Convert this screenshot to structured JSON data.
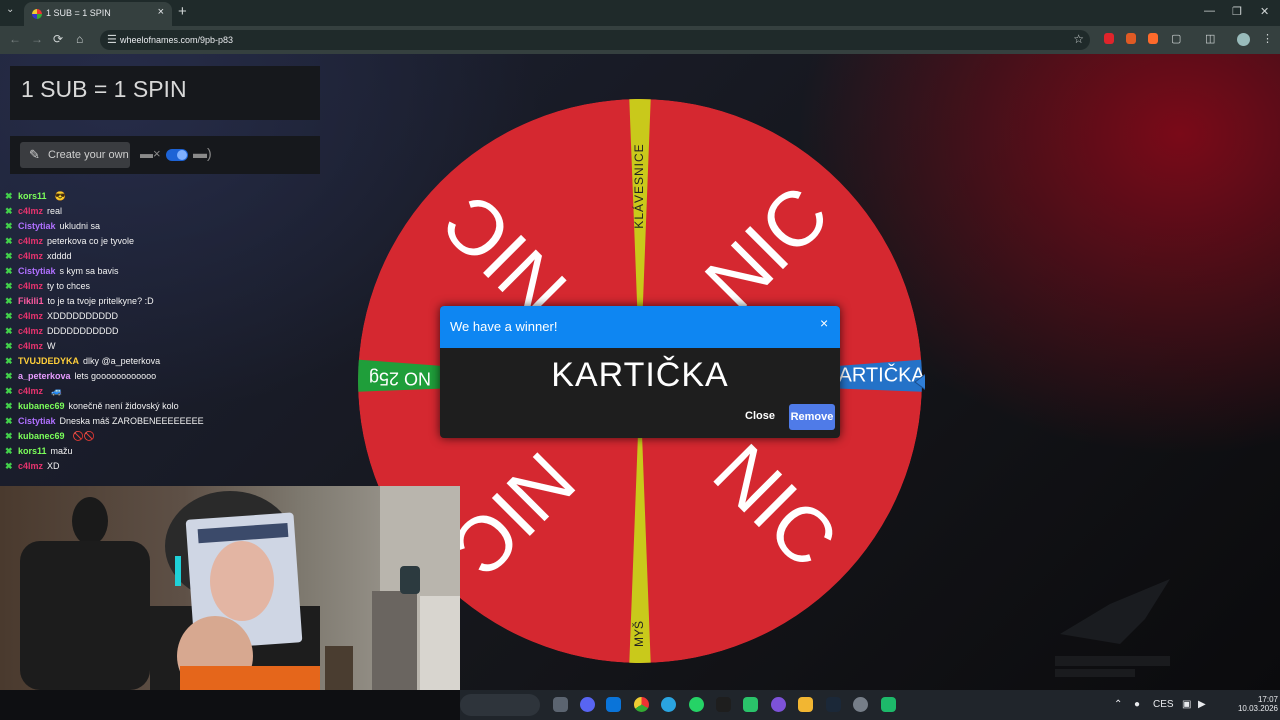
{
  "browser": {
    "tab_title": "1 SUB = 1 SPIN",
    "tab_close": "×",
    "new_tab": "+",
    "url": "wheelofnames.com/9pb-p83"
  },
  "page": {
    "title": "1 SUB = 1 SPIN",
    "create_button_label": "Create your own"
  },
  "wheel": {
    "segments": [
      "NIC",
      "KLÁVESNICE",
      "NIC",
      "KARTIČKA",
      "NIC",
      "MYŠ",
      "NIC",
      "NO 25g"
    ],
    "colors": {
      "red": "#d52830",
      "yellow": "#c9c91b",
      "blue": "#2472c8",
      "green": "#1f9e3a"
    }
  },
  "chat": {
    "messages": [
      {
        "user": "kors11",
        "color": "#7bff5a",
        "text": "",
        "emote": "😎"
      },
      {
        "user": "c4lmz",
        "color": "#e7336e",
        "text": "real",
        "emote": ""
      },
      {
        "user": "Cistytiak",
        "color": "#b070ff",
        "text": "ukludni sa",
        "emote": ""
      },
      {
        "user": "c4lmz",
        "color": "#e7336e",
        "text": "peterkova co je tyvole",
        "emote": ""
      },
      {
        "user": "c4lmz",
        "color": "#e7336e",
        "text": "xdddd",
        "emote": ""
      },
      {
        "user": "Cistytiak",
        "color": "#b070ff",
        "text": "s kym sa bavis",
        "emote": ""
      },
      {
        "user": "c4lmz",
        "color": "#e7336e",
        "text": "ty to chces",
        "emote": ""
      },
      {
        "user": "Fikili1",
        "color": "#ff5aa0",
        "text": "to je ta tvoje pritelkyne? :D",
        "emote": ""
      },
      {
        "user": "c4lmz",
        "color": "#e7336e",
        "text": "XDDDDDDDDDD",
        "emote": ""
      },
      {
        "user": "c4lmz",
        "color": "#e7336e",
        "text": "DDDDDDDDDDD",
        "emote": ""
      },
      {
        "user": "c4lmz",
        "color": "#e7336e",
        "text": "W",
        "emote": ""
      },
      {
        "user": "TVUJDEDYKA",
        "color": "#ffcf3a",
        "text": "dlky @a_peterkova",
        "emote": ""
      },
      {
        "user": "a_peterkova",
        "color": "#e89cff",
        "text": "lets goooooooooooo",
        "emote": ""
      },
      {
        "user": "c4lmz",
        "color": "#e7336e",
        "text": "",
        "emote": "🚙"
      },
      {
        "user": "kubanec69",
        "color": "#7bff5a",
        "text": "konečně není židovský kolo",
        "emote": ""
      },
      {
        "user": "Cistytiak",
        "color": "#b070ff",
        "text": "Dneska máš ZAROBENEEEEEEEE",
        "emote": ""
      },
      {
        "user": "kubanec69",
        "color": "#7bff5a",
        "text": "",
        "emote": "🚫🚫"
      },
      {
        "user": "kors11",
        "color": "#7bff5a",
        "text": "mažu",
        "emote": ""
      },
      {
        "user": "c4lmz",
        "color": "#e7336e",
        "text": "XD",
        "emote": ""
      }
    ]
  },
  "dialog": {
    "title": "We have a winner!",
    "winner": "KARTIČKA",
    "close_label": "Close",
    "remove_label": "Remove",
    "x_label": "×"
  },
  "taskbar": {
    "language": "CES",
    "time": "17:07",
    "date": "10.03.2026"
  },
  "icons": {
    "back": "←",
    "forward": "→",
    "reload": "⟳",
    "home": "⌂",
    "tune": "☰",
    "star": "☆",
    "pencil": "✎",
    "mute": "🔇",
    "volume": "🔊",
    "chevron": "⌄"
  }
}
